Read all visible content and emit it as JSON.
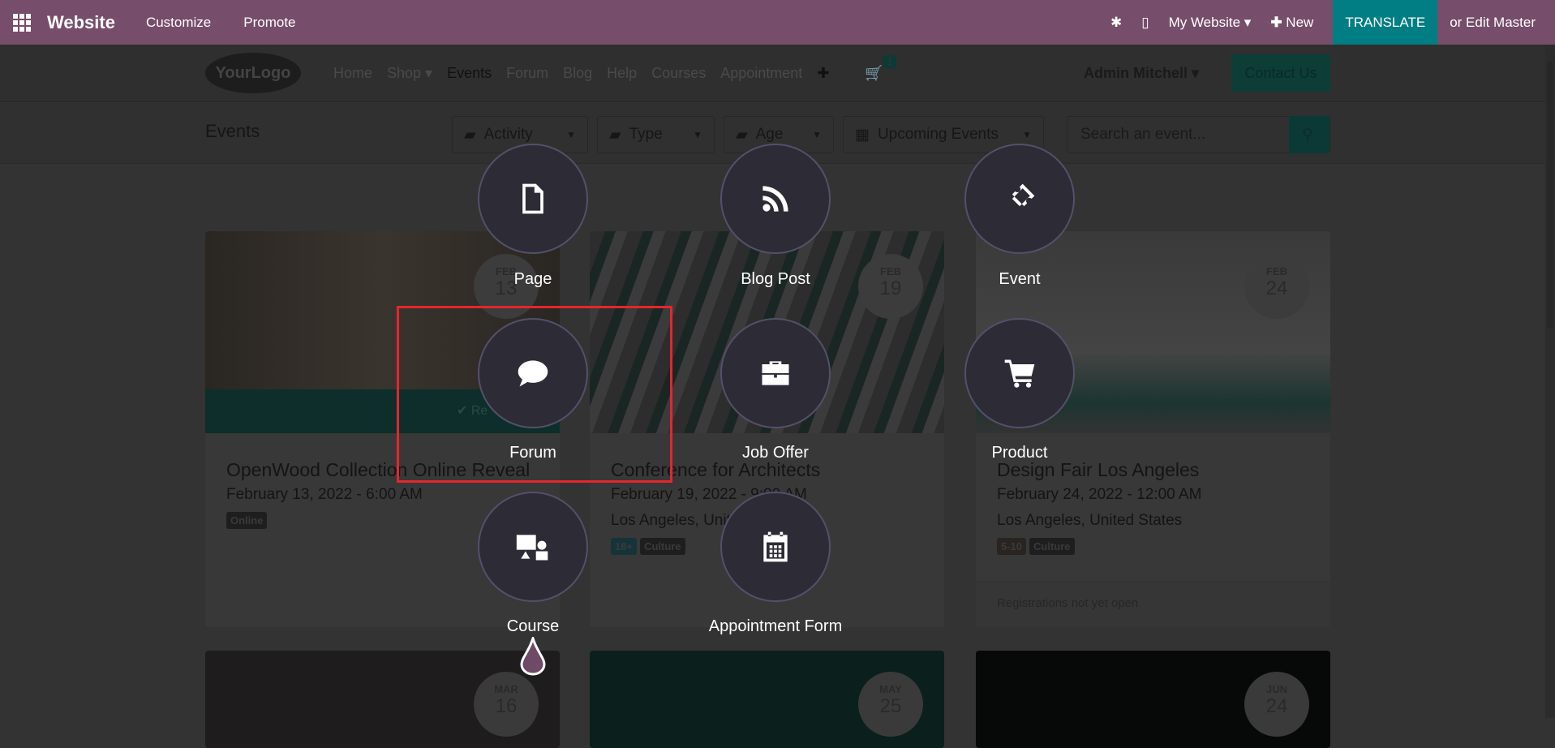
{
  "topbar": {
    "brand": "Website",
    "customize": "Customize",
    "promote": "Promote",
    "my_website": "My Website ▾",
    "new": "New",
    "translate": "TRANSLATE",
    "edit_master": "or Edit Master",
    "color": "#764d6a"
  },
  "nav": {
    "logo": "YourLogo",
    "links": [
      "Home",
      "Shop ▾",
      "Events",
      "Forum",
      "Blog",
      "Help",
      "Courses",
      "Appointment"
    ],
    "cart_count": "1",
    "user": "Admin Mitchell ▾",
    "contact": "Contact Us"
  },
  "header": {
    "title": "Events",
    "filters": [
      "Activity",
      "Type",
      "Age",
      "Upcoming Events"
    ],
    "search_placeholder": "Search an event..."
  },
  "cards": [
    {
      "month": "FEB",
      "day": "13",
      "title": "OpenWood Collection Online Reveal",
      "date": "February 13, 2022 - 6:00 AM",
      "location": "",
      "tags": [
        "Online"
      ],
      "ribbon": "✔ Re"
    },
    {
      "month": "FEB",
      "day": "19",
      "title": "Conference for Architects",
      "date": "February 19, 2022 - 9:00 AM",
      "location": "Los Angeles, United States",
      "tags": [
        "18+",
        "Culture"
      ]
    },
    {
      "month": "FEB",
      "day": "24",
      "title": "Design Fair Los Angeles",
      "date": "February 24, 2022 - 12:00 AM",
      "location": "Los Angeles, United States",
      "tags": [
        "5-10",
        "Culture"
      ],
      "footer": "Registrations not yet open"
    },
    {
      "month": "MAR",
      "day": "16"
    },
    {
      "month": "MAY",
      "day": "25"
    },
    {
      "month": "JUN",
      "day": "24"
    }
  ],
  "new_menu": [
    {
      "label": "Page",
      "icon": "file-icon"
    },
    {
      "label": "Blog Post",
      "icon": "rss-icon"
    },
    {
      "label": "Event",
      "icon": "ticket-icon"
    },
    {
      "label": "Forum",
      "icon": "comment-icon"
    },
    {
      "label": "Job Offer",
      "icon": "briefcase-icon"
    },
    {
      "label": "Product",
      "icon": "cart-icon"
    },
    {
      "label": "Course",
      "icon": "presentation-icon"
    },
    {
      "label": "Appointment Form",
      "icon": "calendar-icon"
    }
  ],
  "highlight_color": "#e5262b"
}
